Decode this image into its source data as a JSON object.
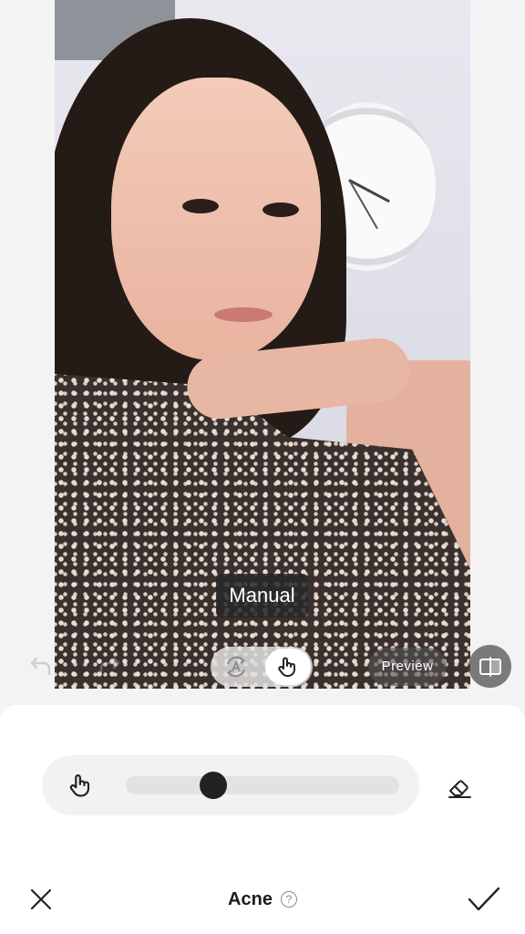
{
  "tooltip": {
    "text": "Manual"
  },
  "overlay": {
    "undo_icon": "undo-icon",
    "redo_icon": "redo-icon",
    "mode_switch": {
      "options": [
        {
          "name": "auto",
          "icon": "auto-a-icon"
        },
        {
          "name": "manual",
          "icon": "hand-icon",
          "selected": true
        }
      ]
    },
    "preview_label": "Preview",
    "compare_icon": "compare-icon"
  },
  "brush_panel": {
    "brush_icon": "hand-icon",
    "size_level": 0.32,
    "eraser_icon": "eraser-icon"
  },
  "footer": {
    "title": "Acne",
    "help_glyph": "?",
    "cancel_icon": "close-icon",
    "confirm_icon": "checkmark-icon"
  }
}
